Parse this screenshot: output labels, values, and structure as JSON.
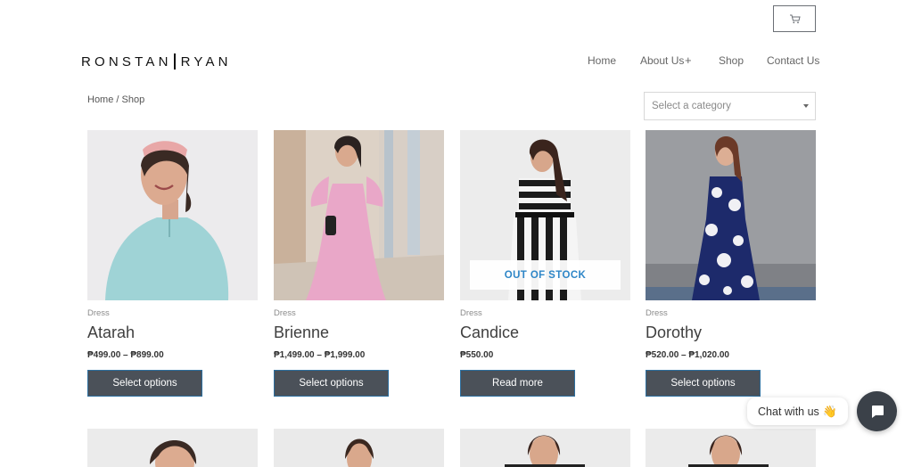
{
  "brand": {
    "left": "RONSTAN",
    "right": "RYAN"
  },
  "nav": {
    "home": "Home",
    "about": "About Us",
    "about_plus": "+",
    "shop": "Shop",
    "contact": "Contact Us"
  },
  "breadcrumb": "Home / Shop",
  "category_select": {
    "value": "Select a category"
  },
  "products": [
    {
      "category": "Dress",
      "name": "Atarah",
      "price": "₱499.00 – ₱899.00",
      "button": "Select options"
    },
    {
      "category": "Dress",
      "name": "Brienne",
      "price": "₱1,499.00 – ₱1,999.00",
      "button": "Select options"
    },
    {
      "category": "Dress",
      "name": "Candice",
      "price": "₱550.00",
      "button": "Read more",
      "badge": "OUT OF STOCK"
    },
    {
      "category": "Dress",
      "name": "Dorothy",
      "price": "₱520.00 – ₱1,020.00",
      "button": "Select options"
    }
  ],
  "chat": {
    "label": "Chat with us",
    "emoji": "👋"
  },
  "icons": {
    "cart": "cart-icon",
    "caret": "caret-down-icon",
    "chat": "chat-bubble-icon"
  }
}
